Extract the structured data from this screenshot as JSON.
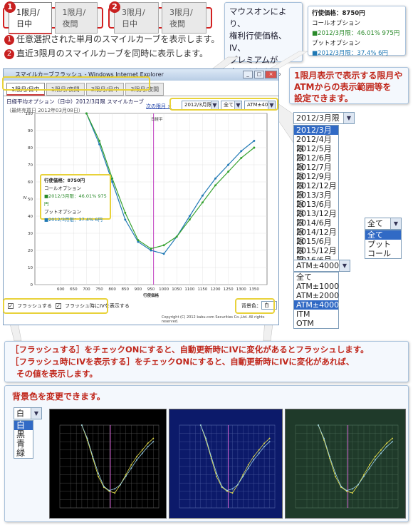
{
  "badges": {
    "one": "1",
    "two": "2"
  },
  "top_tabs": {
    "day": "1限月/日中",
    "night": "1限月/夜間",
    "day3": "3限月/日中",
    "night3": "3限月/夜間"
  },
  "notes": {
    "one": "任意選択された単月のスマイルカーブを表示します。",
    "two": "直近3限月のスマイルカーブを同時に表示します。"
  },
  "hover_note": {
    "l1": "マウスオンにより、",
    "l2": "権利行使価格、IV、",
    "l3": "プレミアムが",
    "l4": "表示されます。"
  },
  "tooltip": {
    "title": "行使価格：8750円",
    "call": "コールオプション",
    "call_val": "■2012/3月限：46.01% 975円",
    "put": "プットオプション",
    "put_val": "■2012/3月限：37.4% 6円"
  },
  "range_note": {
    "l1": "1限月表示で表示する限月や",
    "l2": "ATMからの表示範囲等を",
    "l3": "設定できます。"
  },
  "window": {
    "title": "スマイルカーブフラッシュ - Windows Internet Explorer",
    "tabs": [
      "1限月/日中",
      "1限月/夜間",
      "3限月/日中",
      "3限月/夜間"
    ],
    "chart_title": "日経平均オプション（日中）2012/3月限 スマイルカーブ",
    "sub": "（最終売買日 2012年03月08日）",
    "next": "次の限月 >",
    "month_sel": "2012/3月限",
    "type_sel": "全て",
    "atm_sel": "ATM±4000",
    "flash": "フラッシュする",
    "flash_iv": "フラッシュ時にIVを表示する",
    "bg_label": "背景色：",
    "bg_val": "白",
    "copyright": "Copyright (C) 2012 kabu.com Securities Co.,Ltd. All rights reserved.",
    "legend": "日経平"
  },
  "month_list": {
    "selected": "2012/3月限",
    "items": [
      "2012/3月限",
      "2012/4月限",
      "2012/5月限",
      "2012/6月限",
      "2012/7月限",
      "2012/9月限",
      "2012/12月限",
      "2013/3月限",
      "2013/6月限",
      "2013/12月限",
      "2014/6月限",
      "2014/12月限",
      "2015/6月限",
      "2015/12月限",
      "2016/6月限",
      "2016/12月限"
    ]
  },
  "type_list": {
    "selected": "全て",
    "items": [
      "全て",
      "プット",
      "コール"
    ]
  },
  "atm_list": {
    "selected": "ATM±4000",
    "items": [
      "全て",
      "ATM±1000",
      "ATM±2000",
      "ATM±4000",
      "ITM",
      "OTM"
    ]
  },
  "flash_note": {
    "l1": "［フラッシュする］をチェックONにすると、自動更新時にIVに変化があるとフラッシュします。",
    "l2": "［フラッシュ時にIVを表示する］をチェックONにすると、自動更新時にIVに変化があれば、",
    "l3": "その値を表示します。"
  },
  "bg_note": {
    "title": "背景色を変更できます。",
    "selected": "白",
    "items": [
      "白",
      "黒",
      "青",
      "緑"
    ]
  },
  "chart_data": {
    "type": "line",
    "xlabel": "行使価格",
    "ylabel": "IV",
    "xlim": [
      500,
      1400
    ],
    "ylim": [
      0,
      100
    ],
    "xticks": [
      600,
      650,
      700,
      750,
      800,
      850,
      900,
      950,
      1000,
      1050,
      1100,
      1150,
      1200,
      1250,
      1300,
      1350
    ],
    "yticks": [
      0,
      10,
      20,
      30,
      40,
      50,
      60,
      70,
      80,
      90,
      100
    ],
    "series": [
      {
        "color": "#1f78b4",
        "x": [
          700,
          750,
          800,
          850,
          900,
          950,
          1000,
          1050,
          1100,
          1150,
          1200,
          1250,
          1300,
          1350
        ],
        "y": [
          100,
          82,
          60,
          38,
          25,
          20,
          18,
          28,
          40,
          52,
          62,
          70,
          78,
          84
        ]
      },
      {
        "color": "#33a02c",
        "x": [
          700,
          750,
          800,
          850,
          900,
          950,
          1000,
          1050,
          1100,
          1150,
          1200,
          1250,
          1300,
          1350
        ],
        "y": [
          100,
          84,
          62,
          42,
          26,
          21,
          23,
          28,
          38,
          48,
          58,
          66,
          74,
          80
        ]
      }
    ]
  },
  "colors": {
    "accent": "#c82020",
    "blue": "#1f78b4",
    "green": "#33a02c",
    "yellow": "#e8d23a"
  }
}
